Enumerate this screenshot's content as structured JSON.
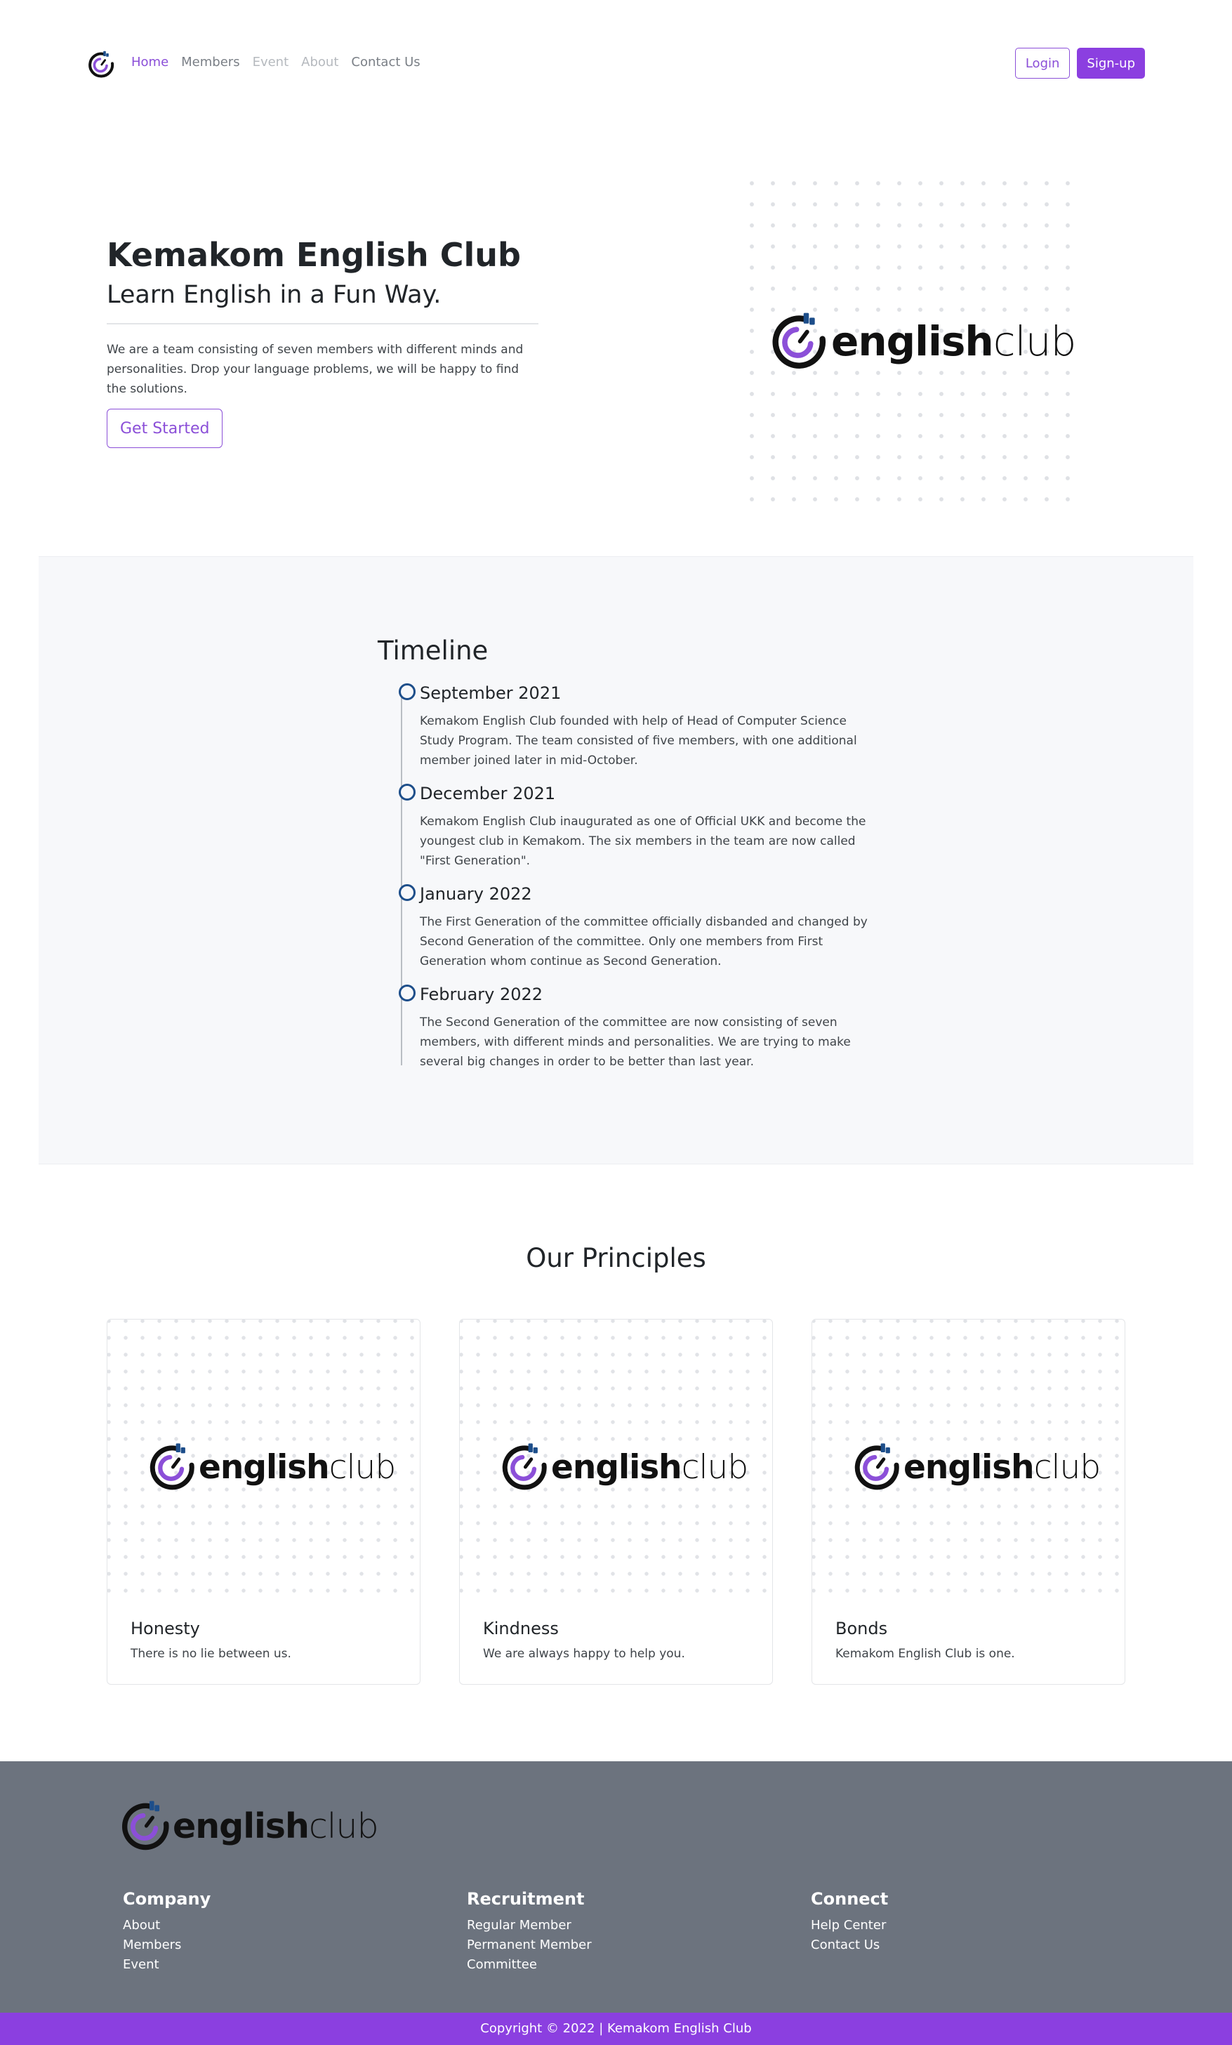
{
  "brand": {
    "logo_bold": "english",
    "logo_light": "club",
    "accent": "#8b4fd8",
    "dark_blue": "#1d4e8a"
  },
  "nav": {
    "links": [
      "Home",
      "Members",
      "Event",
      "About",
      "Contact Us"
    ],
    "login": "Login",
    "signup": "Sign-up"
  },
  "hero": {
    "title": "Kemakom English Club",
    "subtitle": "Learn English in a Fun Way.",
    "description": "We are a team consisting of seven members with different minds and personalities. Drop your language problems, we will be happy to find the solutions.",
    "cta": "Get Started"
  },
  "timeline": {
    "title": "Timeline",
    "items": [
      {
        "date": "September 2021",
        "text": "Kemakom English Club founded with help of Head of Computer Science Study Program. The team consisted of five members, with one additional member joined later in mid-October."
      },
      {
        "date": "December 2021",
        "text": "Kemakom English Club inaugurated as one of Official UKK and become the youngest club in Kemakom. The six members in the team are now called \"First Generation\"."
      },
      {
        "date": "January 2022",
        "text": "The First Generation of the committee officially disbanded and changed by Second Generation of the committee. Only one members from First Generation whom continue as Second Generation."
      },
      {
        "date": "February 2022",
        "text": "The Second Generation of the committee are now consisting of seven members, with different minds and personalities. We are trying to make several big changes in order to be better than last year."
      }
    ]
  },
  "principles": {
    "title": "Our Principles",
    "cards": [
      {
        "title": "Honesty",
        "text": "There is no lie between us."
      },
      {
        "title": "Kindness",
        "text": "We are always happy to help you."
      },
      {
        "title": "Bonds",
        "text": "Kemakom English Club is one."
      }
    ]
  },
  "footer": {
    "columns": [
      {
        "title": "Company",
        "links": [
          "About",
          "Members",
          "Event"
        ]
      },
      {
        "title": "Recruitment",
        "links": [
          "Regular Member",
          "Permanent Member",
          "Committee"
        ]
      },
      {
        "title": "Connect",
        "links": [
          "Help Center",
          "Contact Us"
        ]
      }
    ],
    "copyright": "Copyright © 2022 | Kemakom English Club"
  }
}
